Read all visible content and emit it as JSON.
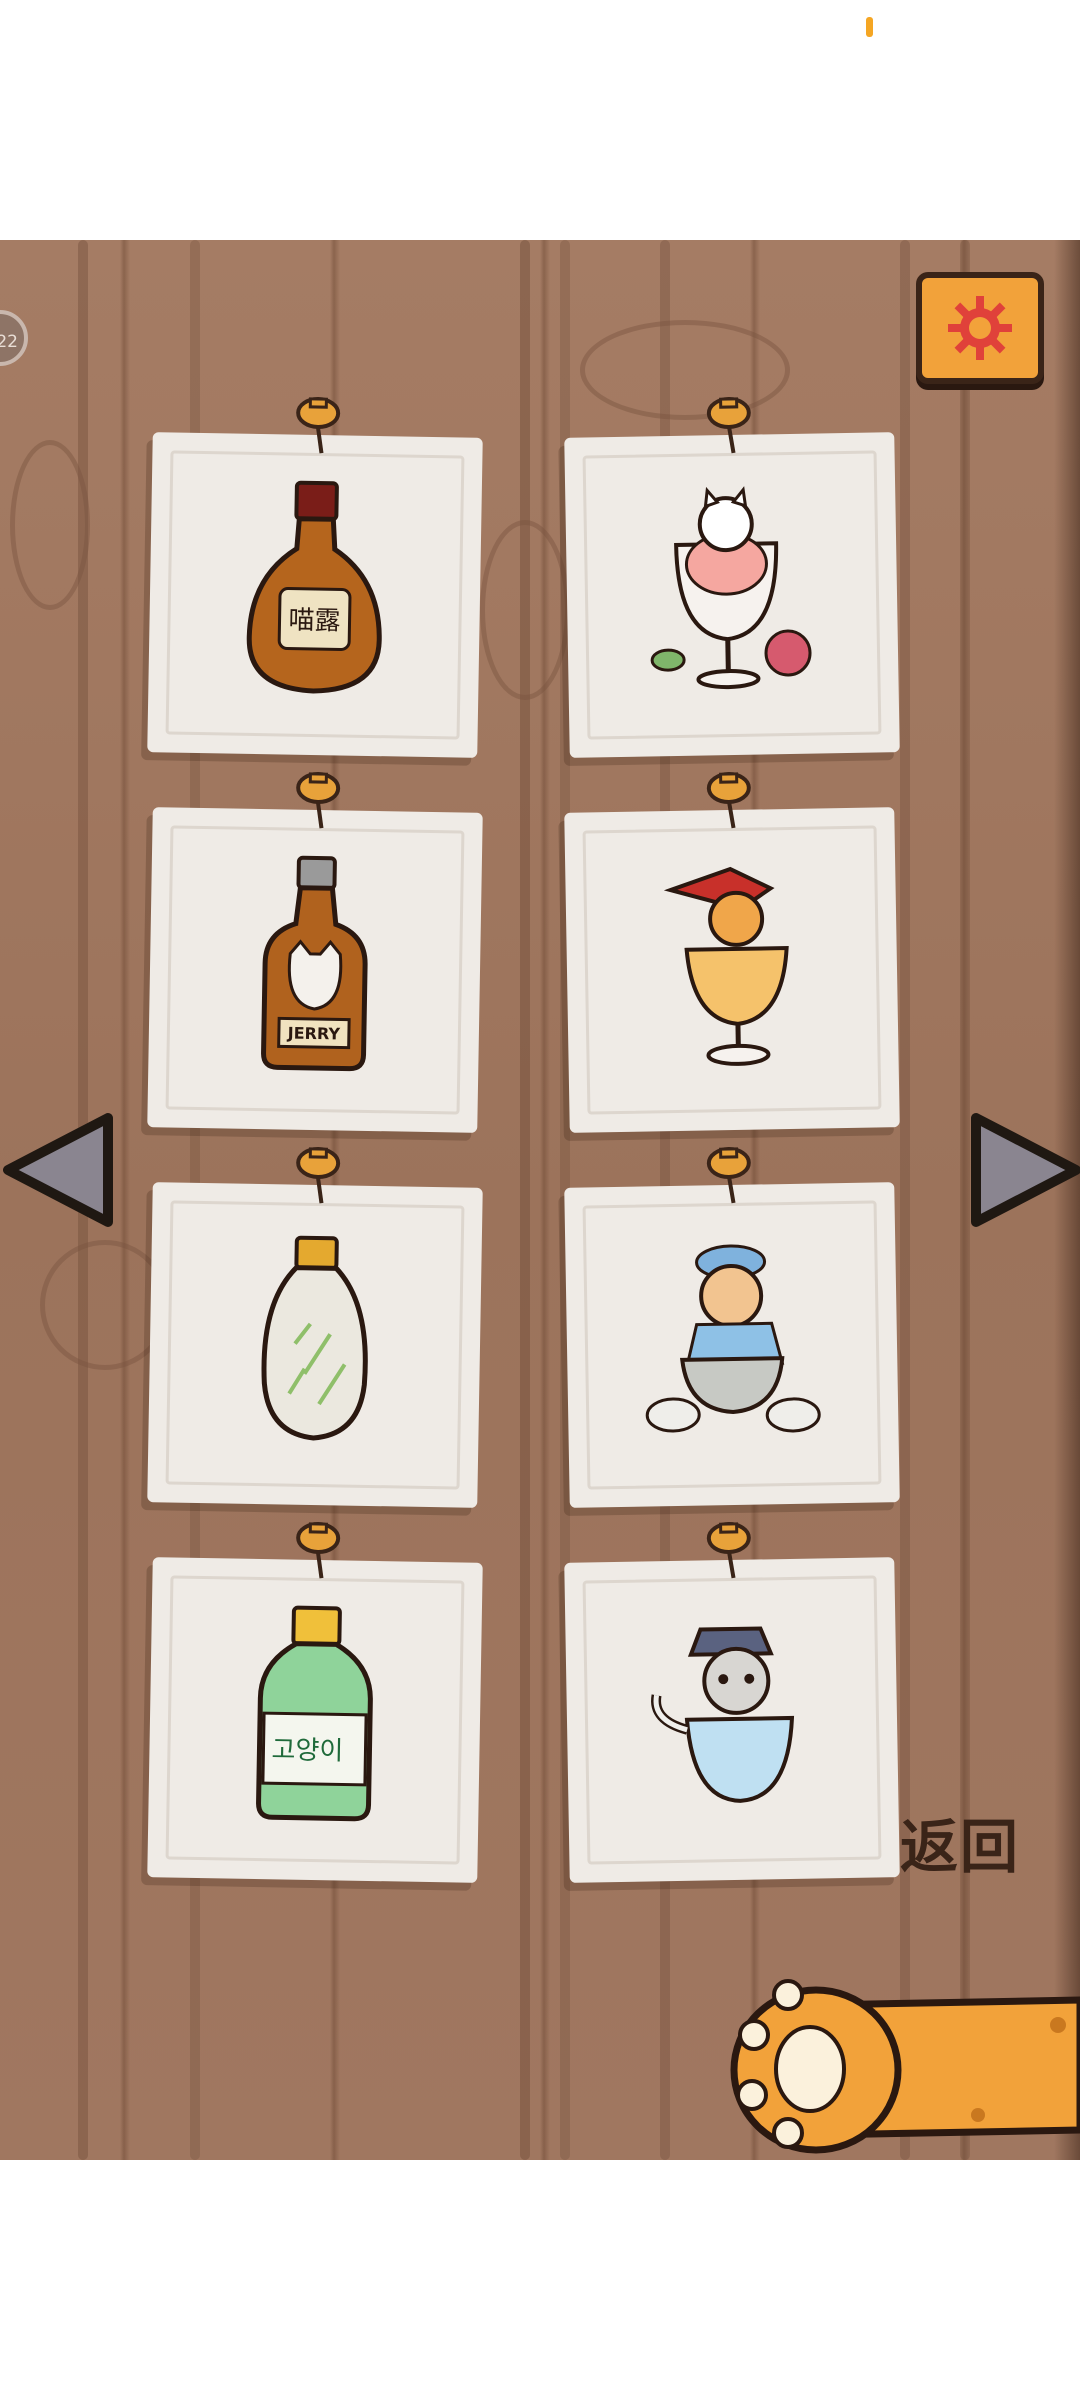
{
  "status_bar": {
    "indicator_color": "#f5a623"
  },
  "hud": {
    "level_badge_text": "22",
    "settings_icon": "gear-icon"
  },
  "collection": {
    "items": [
      {
        "name": "cat-liquor-bottle",
        "label": "喵露"
      },
      {
        "name": "cat-in-wine-glass-with-rose",
        "label": ""
      },
      {
        "name": "cat-whiskey-bottle",
        "label": "JERRY"
      },
      {
        "name": "cat-in-cocktail-glass-with-hat",
        "label": ""
      },
      {
        "name": "porcelain-wine-bottle",
        "label": ""
      },
      {
        "name": "cat-in-tea-cup-with-cloud",
        "label": ""
      },
      {
        "name": "soju-bottle",
        "label": "고양이"
      },
      {
        "name": "cat-in-bowl-with-cap",
        "label": ""
      }
    ]
  },
  "navigation": {
    "prev_icon": "triangle-left-icon",
    "next_icon": "triangle-right-icon"
  },
  "back_button": {
    "label": "返回",
    "icon": "cat-paw-icon"
  },
  "colors": {
    "wood": "#a57c64",
    "accent": "#f2a23a",
    "outline": "#3a2418",
    "card": "#efebe6"
  }
}
